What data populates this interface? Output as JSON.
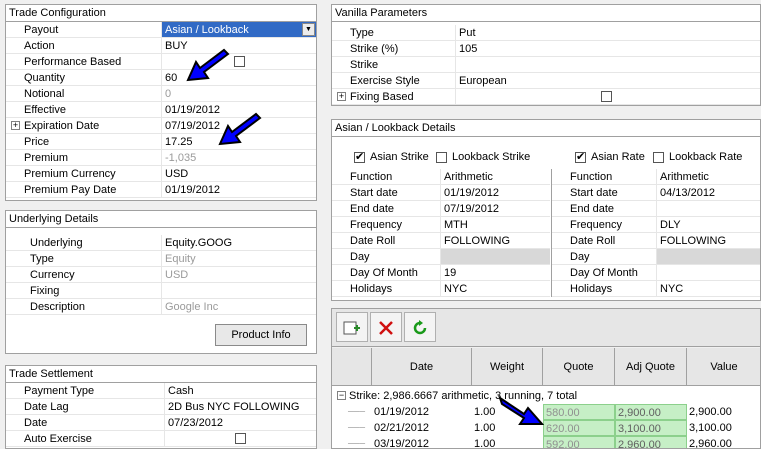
{
  "trade_config": {
    "title": "Trade Configuration",
    "rows": [
      {
        "label": "Payout",
        "value": "Asian / Lookback"
      },
      {
        "label": "Action",
        "value": "BUY"
      },
      {
        "label": "Performance Based",
        "value": ""
      },
      {
        "label": "Quantity",
        "value": "60"
      },
      {
        "label": "Notional",
        "value": "0"
      },
      {
        "label": "Effective",
        "value": "01/19/2012"
      },
      {
        "label": "Expiration Date",
        "value": "07/19/2012"
      },
      {
        "label": "Price",
        "value": "17.25"
      },
      {
        "label": "Premium",
        "value": "-1,035"
      },
      {
        "label": "Premium Currency",
        "value": "USD"
      },
      {
        "label": "Premium Pay Date",
        "value": "01/19/2012"
      }
    ]
  },
  "underlying": {
    "title": "Underlying Details",
    "rows": [
      {
        "label": "Underlying",
        "value": "Equity.GOOG"
      },
      {
        "label": "Type",
        "value": "Equity"
      },
      {
        "label": "Currency",
        "value": "USD"
      },
      {
        "label": "Fixing",
        "value": ""
      },
      {
        "label": "Description",
        "value": "Google Inc"
      }
    ],
    "button": "Product Info"
  },
  "settlement": {
    "title": "Trade Settlement",
    "rows": [
      {
        "label": "Payment Type",
        "value": "Cash"
      },
      {
        "label": "Date Lag",
        "value": "2D Bus NYC FOLLOWING"
      },
      {
        "label": "Date",
        "value": "07/23/2012"
      },
      {
        "label": "Auto Exercise",
        "value": ""
      }
    ]
  },
  "vanilla": {
    "title": "Vanilla Parameters",
    "rows": [
      {
        "label": "Type",
        "value": "Put"
      },
      {
        "label": "Strike (%)",
        "value": "105"
      },
      {
        "label": "Strike",
        "value": ""
      },
      {
        "label": "Exercise Style",
        "value": "European"
      },
      {
        "label": "Fixing Based",
        "value": ""
      }
    ]
  },
  "asian": {
    "title": "Asian / Lookback Details",
    "strike_checks": [
      "Asian Strike",
      "Lookback Strike"
    ],
    "rate_checks": [
      "Asian Rate",
      "Lookback Rate"
    ],
    "strike_rows": [
      {
        "label": "Function",
        "value": "Arithmetic"
      },
      {
        "label": "Start date",
        "value": "01/19/2012"
      },
      {
        "label": "End date",
        "value": "07/19/2012"
      },
      {
        "label": "Frequency",
        "value": "MTH"
      },
      {
        "label": "Date Roll",
        "value": "FOLLOWING"
      },
      {
        "label": "Day",
        "value": ""
      },
      {
        "label": "Day Of Month",
        "value": "19"
      },
      {
        "label": "Holidays",
        "value": "NYC"
      }
    ],
    "rate_rows": [
      {
        "label": "Function",
        "value": "Arithmetic"
      },
      {
        "label": "Start date",
        "value": "04/13/2012"
      },
      {
        "label": "End date",
        "value": ""
      },
      {
        "label": "Frequency",
        "value": "DLY"
      },
      {
        "label": "Date Roll",
        "value": "FOLLOWING"
      },
      {
        "label": "Day",
        "value": ""
      },
      {
        "label": "Day Of Month",
        "value": ""
      },
      {
        "label": "Holidays",
        "value": "NYC"
      }
    ]
  },
  "grid": {
    "headers": [
      "Date",
      "Weight",
      "Quote",
      "Adj Quote",
      "Value"
    ],
    "group": "Strike: 2,986.6667 arithmetic, 3 running, 7 total",
    "rows": [
      [
        "01/19/2012",
        "1.00",
        "580.00",
        "2,900.00",
        "2,900.00"
      ],
      [
        "02/21/2012",
        "1.00",
        "620.00",
        "3,100.00",
        "3,100.00"
      ],
      [
        "03/19/2012",
        "1.00",
        "592.00",
        "2,960.00",
        "2,960.00"
      ]
    ]
  },
  "colors": {
    "selection": "#316ac5",
    "highlight": "#c6efc6",
    "arrow": "#0000ff"
  }
}
